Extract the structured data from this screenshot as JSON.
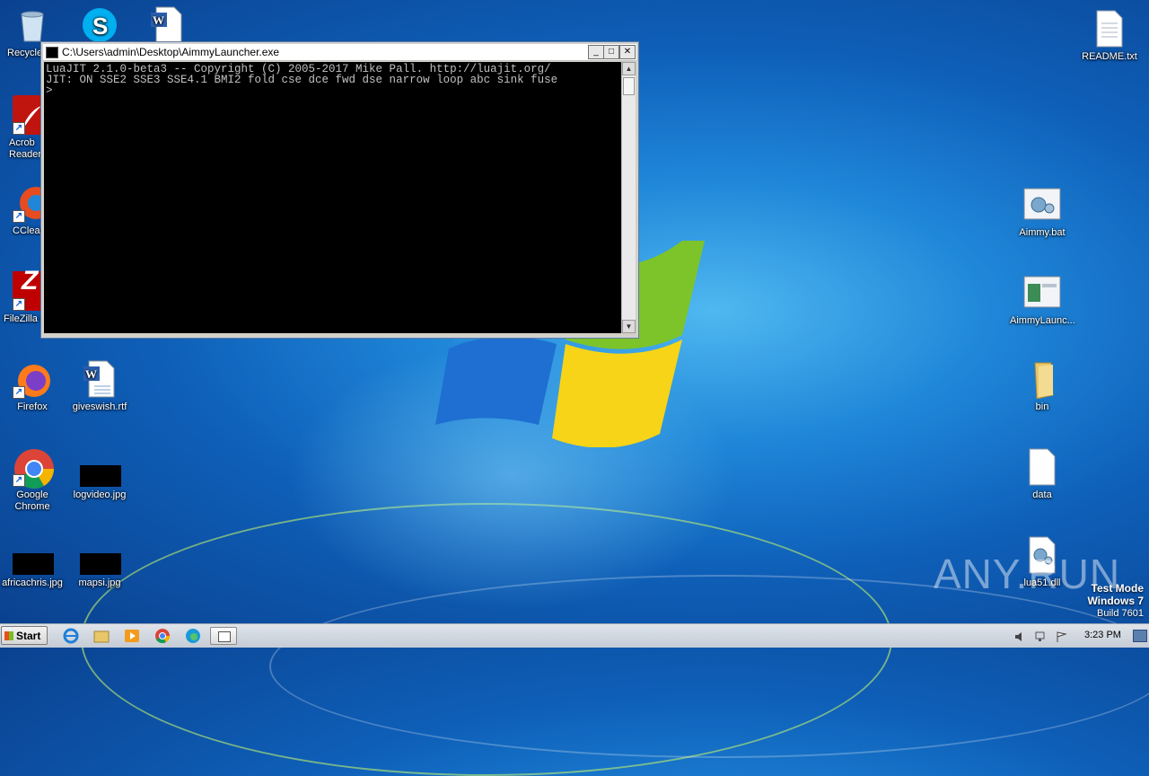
{
  "desktop": {
    "left_icons": [
      {
        "label": "Recycle",
        "icon": "recycle-bin-icon"
      },
      {
        "label": "Acrob\nReader",
        "icon": "acrobat-reader-icon"
      },
      {
        "label": "CClean",
        "icon": "ccleaner-icon"
      },
      {
        "label": "FileZilla C",
        "icon": "filezilla-icon"
      },
      {
        "label": "Firefox",
        "icon": "firefox-icon"
      },
      {
        "label": "giveswish.rtf",
        "icon": "word-document-icon"
      },
      {
        "label": "Google\nChrome",
        "icon": "chrome-icon"
      },
      {
        "label": "logvideo.jpg",
        "icon": "image-file-icon"
      },
      {
        "label": "africachris.jpg",
        "icon": "image-file-icon"
      },
      {
        "label": "mapsi.jpg",
        "icon": "image-file-icon"
      }
    ],
    "right_icons": [
      {
        "label": "README.txt",
        "icon": "text-file-icon"
      },
      {
        "label": "Aimmy.bat",
        "icon": "batch-file-icon"
      },
      {
        "label": "AimmyLaunc...",
        "icon": "executable-icon"
      },
      {
        "label": "bin",
        "icon": "folder-icon"
      },
      {
        "label": "data",
        "icon": "file-icon"
      },
      {
        "label": "lua51.dll",
        "icon": "dll-file-icon"
      }
    ]
  },
  "console": {
    "title": "C:\\Users\\admin\\Desktop\\AimmyLauncher.exe",
    "lines": [
      "LuaJIT 2.1.0-beta3 -- Copyright (C) 2005-2017 Mike Pall. http://luajit.org/",
      "JIT: ON SSE2 SSE3 SSE4.1 BMI2 fold cse dce fwd dse narrow loop abc sink fuse",
      ">"
    ],
    "buttons": {
      "minimize": "_",
      "maximize": "□",
      "close": "✕"
    }
  },
  "watermark": "ANY.RUN",
  "os_info": {
    "line1": "Test Mode",
    "line2": "Windows 7",
    "line3": "Build 7601"
  },
  "taskbar": {
    "start_label": "Start",
    "clock": "3:23 PM",
    "pinned": [
      "ie-icon",
      "explorer-icon",
      "media-player-icon",
      "chrome-icon",
      "edge-icon",
      "console-app-icon"
    ]
  }
}
